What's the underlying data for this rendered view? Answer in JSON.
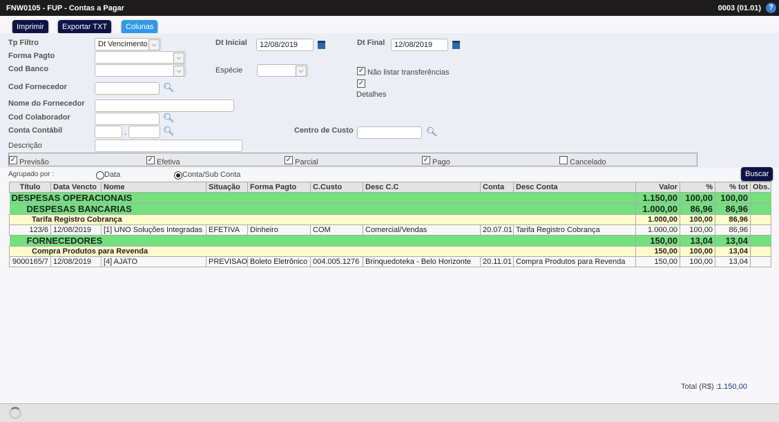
{
  "window": {
    "title": "FNW0105 - FUP - Contas a Pagar",
    "version": "0003 (01.01)",
    "help_icon": "?"
  },
  "toolbar": {
    "print": "Imprimir",
    "export": "Exportar TXT",
    "columns": "Colunas",
    "search": "Buscar"
  },
  "filters": {
    "tp_filtro_label": "Tp Filtro",
    "tp_filtro_value": "Dt Vencimento",
    "dt_inicial_label": "Dt Inicial",
    "dt_inicial_value": "12/08/2019",
    "dt_final_label": "Dt Final",
    "dt_final_value": "12/08/2019",
    "forma_pagto_label": "Forma Pagto",
    "cod_banco_label": "Cod Banco",
    "especie_label": "Espécie",
    "nao_listar_label": "Não listar transferências",
    "nao_listar_checked": true,
    "detalhes_label": "Detalhes",
    "detalhes_checked": true,
    "cod_fornecedor_label": "Cod Fornecedor",
    "nome_fornecedor_label": "Nome do Fornecedor",
    "cod_colaborador_label": "Cod Colaborador",
    "conta_contabil_label": "Conta Contábil",
    "centro_custo_label": "Centro de Custo",
    "descricao_label": "Descrição",
    "status": [
      {
        "label": "Previsão",
        "checked": true
      },
      {
        "label": "Efetiva",
        "checked": true
      },
      {
        "label": "Parcial",
        "checked": true
      },
      {
        "label": "Pago",
        "checked": true
      },
      {
        "label": "Cancelado",
        "checked": false
      }
    ],
    "agrupado_label": "Agrupado por :",
    "group_options": [
      {
        "label": "Data",
        "selected": false
      },
      {
        "label": "Conta/Sub Conta",
        "selected": true
      }
    ]
  },
  "table": {
    "headers": [
      "Título",
      "Data Vencto",
      "Nome",
      "Situação",
      "Forma Pagto",
      "C.Custo",
      "Desc C.C",
      "Conta",
      "Desc Conta",
      "Valor",
      "%",
      "% tot",
      "Obs."
    ],
    "rows": [
      {
        "type": "g1",
        "label": "DESPESAS OPERACIONAIS",
        "indent": 0,
        "valor": "1.150,00",
        "pct": "100,00",
        "pct_tot": "100,00"
      },
      {
        "type": "g1",
        "label": "DESPESAS BANCARIAS",
        "indent": 1,
        "valor": "1.000,00",
        "pct": "86,96",
        "pct_tot": "86,96"
      },
      {
        "type": "y",
        "label": "Tarifa Registro Cobrança",
        "valor": "1.000,00",
        "pct": "100,00",
        "pct_tot": "86,96"
      },
      {
        "type": "d",
        "cells": [
          "123/6",
          "12/08/2019",
          "[1] UNO Soluções Integradas",
          "EFETIVA",
          "Dinheiro",
          "COM",
          "Comercial/Vendas",
          "20.07.01",
          "Tarifa Registro Cobrança",
          "1.000,00",
          "100,00",
          "86,96",
          ""
        ]
      },
      {
        "type": "g1",
        "label": "FORNECEDORES",
        "indent": 1,
        "valor": "150,00",
        "pct": "13,04",
        "pct_tot": "13,04"
      },
      {
        "type": "y",
        "label": "Compra Produtos para Revenda",
        "valor": "150,00",
        "pct": "100,00",
        "pct_tot": "13,04"
      },
      {
        "type": "d",
        "cells": [
          "9000165/7",
          "12/08/2019",
          "[4] AJATO",
          "PREVISAO",
          "Boleto Eletrônico",
          "004.005.1276",
          "Brinquedoteka - Belo Horizonte",
          "20.11.01",
          "Compra Produtos para Revenda",
          "150,00",
          "100,00",
          "13,04",
          ""
        ]
      }
    ]
  },
  "total_label": "Total (R$) :",
  "total_value": "1.150,00"
}
